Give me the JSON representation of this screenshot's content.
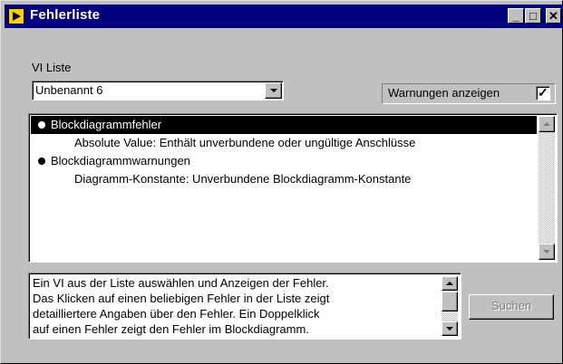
{
  "window": {
    "title": "Fehlerliste",
    "buttons": {
      "minimize": "_",
      "maximize": "□",
      "close": "✕"
    }
  },
  "vi_list": {
    "label": "VI Liste",
    "selected": "Unbenannt 6"
  },
  "warnings": {
    "label": "Warnungen anzeigen",
    "checked": true,
    "check_glyph": "✓"
  },
  "error_list": {
    "items": [
      {
        "text": "Blockdiagrammfehler",
        "type": "header",
        "selected": true
      },
      {
        "text": "Absolute Value: Enthält unverbundene oder ungültige Anschlüsse",
        "type": "detail",
        "selected": false
      },
      {
        "text": "Blockdiagrammwarnungen",
        "type": "header",
        "selected": false
      },
      {
        "text": "Diagramm-Konstante: Unverbundene Blockdiagramm-Konstante",
        "type": "detail",
        "selected": false
      }
    ]
  },
  "description": {
    "lines": [
      "Ein VI aus der Liste auswählen und Anzeigen der Fehler.",
      "Das Klicken auf einen beliebigen Fehler in der Liste zeigt",
      "detailliertere Angaben über den Fehler. Ein Doppelklick",
      "auf einen Fehler zeigt den Fehler im Blockdiagramm."
    ]
  },
  "search_button": {
    "label": "Suchen",
    "enabled": false
  }
}
